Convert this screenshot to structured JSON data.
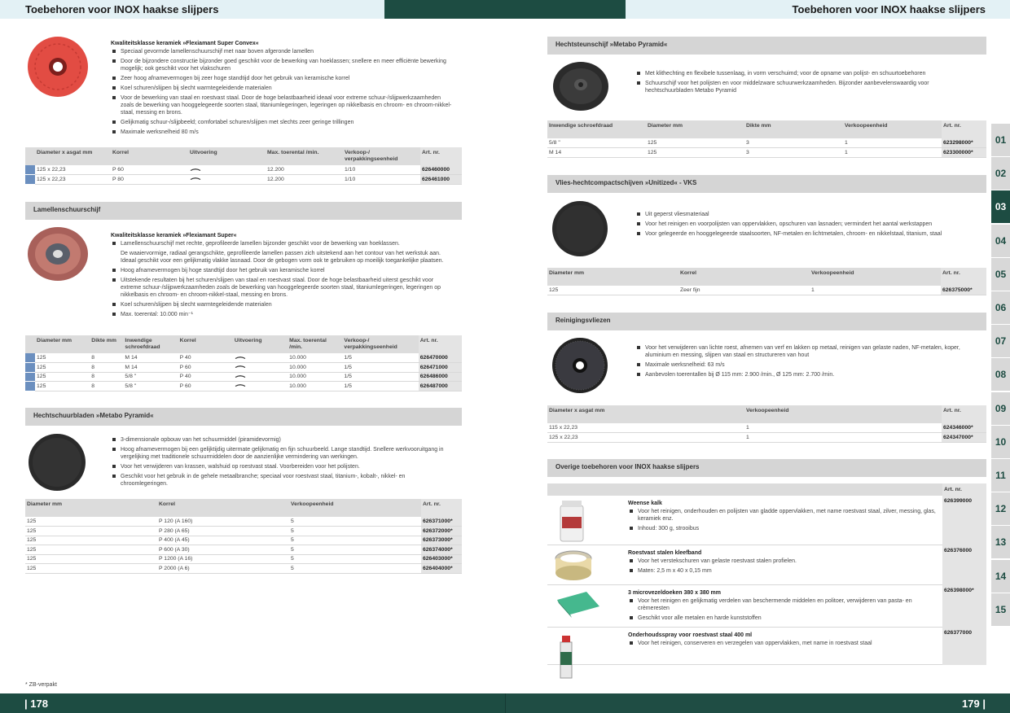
{
  "header": {
    "left_title": "Toebehoren voor INOX haakse slijpers",
    "right_title": "Toebehoren voor INOX haakse slijpers"
  },
  "colors": {
    "brand_green": "#1d4c42",
    "light_cyan": "#e3f1f5",
    "section_grey": "#d5d5d5",
    "blue_mark": "#6b8fbf"
  },
  "left": {
    "s1": {
      "title": "Kwaliteitsklasse keramiek »Flexiamant Super Convex«",
      "bullets": [
        "Speciaal gevormde lamellenschuurschijf met naar boven afgeronde lamellen",
        "Door de bijzondere constructie bijzonder goed geschikt voor de bewerking van hoeklassen; snellere en meer efficiënte bewerking mogelijk; ook geschikt voor het vlakschuren",
        "Zeer hoog afnamevermogen bij zeer hoge standtijd door het gebruik van keramische korrel",
        "Koel schuren/slijpen bij slecht warmtegeleidende materialen",
        "Voor de bewerking van staal en roestvast staal. Door de hoge belastbaarheid ideaal voor extreme schuur-/slijpwerkzaamheden zoals de bewerking van hooggelegeerde soorten staal, titaniumlegeringen, legeringen op nikkelbasis en chroom- en chroom-nikkel-staal, messing en brons.",
        "Gelijkmatig schuur-/slijpbeeld; comfortabel schuren/slijpen met slechts zeer geringe trillingen",
        "Maximale werksnelheid 80 m/s"
      ],
      "headers": [
        "Diameter x asgat mm",
        "Korrel",
        "Uitvoering",
        "Max. toerental /min.",
        "Verkoop-/ verpakkingseenheid",
        "Art. nr."
      ],
      "rows": [
        [
          "125 x 22,23",
          "P 60",
          "12.200",
          "1/10",
          "626460000"
        ],
        [
          "125 x 22,23",
          "P 80",
          "12.200",
          "1/10",
          "626461000"
        ]
      ]
    },
    "s2": {
      "bar": "Lamellenschuurschijf",
      "title": "Kwaliteitsklasse keramiek »Flexiamant Super«",
      "bullets": [
        "Lamellenschuurschijf met rechte, geprofileerde lamellen bijzonder geschikt voor de bewerking van hoeklassen.",
        "Hoog afnamevermogen bij hoge standtijd door het gebruik van keramische korrel",
        "Uitstekende resultaten bij het schuren/slijpen van staal en roestvast staal. Door de hoge belastbaarheid uiterst geschikt voor extreme schuur-/slijpwerkzaamheden zoals de bewerking van hooggelegeerde soorten staal, titaniumlegeringen, legeringen op nikkelbasis en chroom- en chroom-nikkel-staal, messing en brons.",
        "Koel schuren/slijpen bij slecht warmtegeleidende materialen",
        "Max. toerental: 10.000 min⁻¹"
      ],
      "extra": "De waaiervormige, radiaal gerangschikte, geprofileerde lamellen passen zich uitstekend aan het contour van het werkstuk aan. Ideaal geschikt voor een gelijkmatig vlakke lasnaad. Door de gebogen vorm ook te gebruiken op moeilijk toegankelijke plaatsen.",
      "headers": [
        "Diameter mm",
        "Dikte mm",
        "Inwendige schroefdraad",
        "Korrel",
        "Uitvoering",
        "Max. toerental /min.",
        "Verkoop-/ verpakkingseenheid",
        "Art. nr."
      ],
      "rows": [
        [
          "125",
          "8",
          "M 14",
          "P 40",
          "10.000",
          "1/5",
          "626470000"
        ],
        [
          "125",
          "8",
          "M 14",
          "P 60",
          "10.000",
          "1/5",
          "626471000"
        ],
        [
          "125",
          "8",
          "5/8 \"",
          "P 40",
          "10.000",
          "1/5",
          "626486000"
        ],
        [
          "125",
          "8",
          "5/8 \"",
          "P 60",
          "10.000",
          "1/5",
          "626487000"
        ]
      ]
    },
    "s3": {
      "bar": "Hechtschuurbladen »Metabo Pyramid«",
      "bullets": [
        "3-dimensionale opbouw van het schuurmiddel (piramidevormig)",
        "Hoog afnamevermogen bij een gelijktijdig uitermate gelijkmatig en fijn schuurbeeld. Lange standtijd. Snellere werkvooruitgang in vergelijking met traditionele schuurmiddelen door de aanzienlijke vermindering van werkingen.",
        "Voor het verwijderen van krassen, walshuid op roestvast staal. Voorbereiden voor het polijsten.",
        "Geschikt voor het gebruik in de gehele metaalbranche; speciaal voor roestvast staal, titanium-, kobalt-, nikkel- en chroomlegeringen."
      ],
      "headers": [
        "Diameter mm",
        "Korrel",
        "Verkoopeenheid",
        "Art. nr."
      ],
      "rows": [
        [
          "125",
          "P 120 (A 160)",
          "5",
          "626371000*"
        ],
        [
          "125",
          "P 280 (A 65)",
          "5",
          "626372000*"
        ],
        [
          "125",
          "P 400 (A 45)",
          "5",
          "626373000*"
        ],
        [
          "125",
          "P 600 (A 30)",
          "5",
          "626374000*"
        ],
        [
          "125",
          "P 1200 (A 16)",
          "5",
          "626403000*"
        ],
        [
          "125",
          "P 2000 (A 6)",
          "5",
          "626404000*"
        ]
      ]
    },
    "footnote": "* ZB-verpakt",
    "page": "| 178"
  },
  "right": {
    "r1": {
      "bar": "Hechtsteunschijf »Metabo Pyramid«",
      "bullets": [
        "Met klithechting en flexibele tussenlaag, in vorm verschuimd; voor de opname van polijst- en schuurtoebehoren",
        "Schuurschijf voor het polijsten en voor middelzware schuurwerkzaamheden. Bijzonder aanbevelenswaardig voor hechtschuurbladen Metabo Pyramid"
      ],
      "headers": [
        "Inwendige schroefdraad",
        "Diameter mm",
        "Dikte mm",
        "Verkoopeenheid",
        "Art. nr."
      ],
      "rows": [
        [
          "5/8 \"",
          "125",
          "3",
          "1",
          "623298000*"
        ],
        [
          "M 14",
          "125",
          "3",
          "1",
          "623300000*"
        ]
      ]
    },
    "r2": {
      "bar": "Vlies-hechtcompactschijven »Unitized« - VKS",
      "bullets": [
        "Uit geperst vliesmateriaal",
        "Voor het reinigen en voorpolijsten van oppervlakken, opschuren van lasnaden; vermindert het aantal werkstappen",
        "Voor gelegeerde en hooggelegeerde staalsoorten, NF-metalen en lichtmetalen, chroom- en nikkelstaal, titanium, staal"
      ],
      "headers": [
        "Diameter mm",
        "Korrel",
        "Verkoopeenheid",
        "Art. nr."
      ],
      "rows": [
        [
          "125",
          "Zeer fijn",
          "1",
          "626375000*"
        ]
      ]
    },
    "r3": {
      "bar": "Reinigingsvliezen",
      "bullets": [
        "Voor het verwijderen van lichte roest, afnemen van verf en lakken op metaal, reinigen van gelaste naden, NF-metalen, koper, aluminium en messing, slijpen van staal en structureren van hout",
        "Maximale werksnelheid: 63 m/s",
        "Aanbevolen toerentallen bij Ø 115 mm: 2.900 /min., Ø 125 mm: 2.700 /min."
      ],
      "headers": [
        "Diameter x asgat mm",
        "Verkoopeenheid",
        "Art. nr."
      ],
      "rows": [
        [
          "115 x 22,23",
          "1",
          "624346000*"
        ],
        [
          "125 x 22,23",
          "1",
          "624347000*"
        ]
      ]
    },
    "r4": {
      "bar": "Overige toebehoren voor INOX haakse slijpers",
      "art_header": "Art. nr.",
      "items": [
        {
          "name": "Weense kalk",
          "bullets": [
            "Voor het reinigen, onderhouden en polijsten van gladde oppervlakken, met name roestvast staal, zilver, messing, glas, keramiek enz.",
            "Inhoud: 300 g, strooibus"
          ],
          "art": "626399000"
        },
        {
          "name": "Roestvast stalen kleefband",
          "bullets": [
            "Voor het verstekschuren van gelaste roestvast stalen profielen.",
            "Maten: 2,5 m x 40 x 0,15 mm"
          ],
          "art": "626376000"
        },
        {
          "name": "3 microvezeldoeken 380 x 380 mm",
          "bullets": [
            "Voor het reinigen en gelijkmatig verdelen van beschermende middelen en politoer, verwijderen van pasta- en crèmeresten",
            "Geschikt voor alle metalen en harde kunststoffen"
          ],
          "art": "626398000*"
        },
        {
          "name": "Onderhoudsspray voor roestvast staal 400 ml",
          "bullets": [
            "Voor het reinigen, conserveren en verzegelen van oppervlakken, met name in roestvast staal"
          ],
          "art": "626377000"
        }
      ]
    },
    "page": "179 |"
  },
  "tabs": [
    "01",
    "02",
    "03",
    "04",
    "05",
    "06",
    "07",
    "08",
    "09",
    "10",
    "11",
    "12",
    "13",
    "14",
    "15"
  ],
  "active_tab": "03"
}
